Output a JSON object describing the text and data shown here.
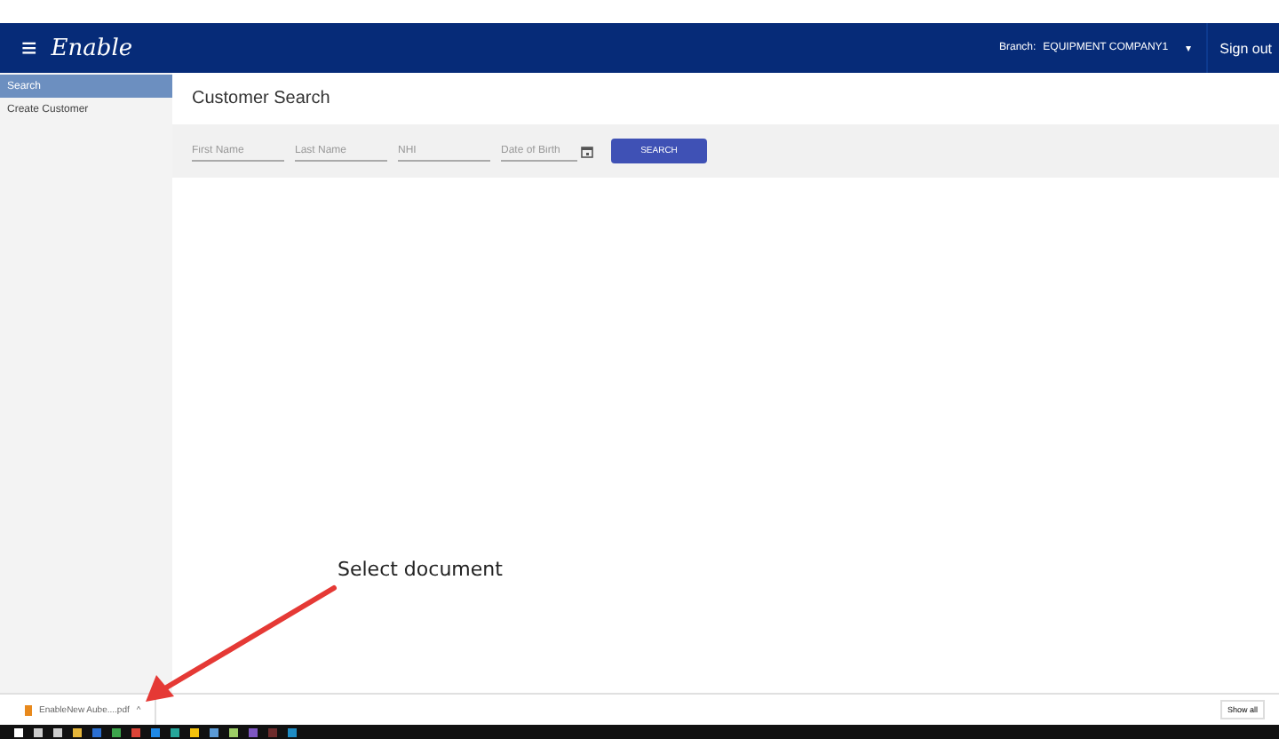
{
  "header": {
    "menu_icon": "≡",
    "logo": "Enable",
    "branch_label": "Branch:",
    "branch_value": "EQUIPMENT COMPANY1",
    "caret": "▾",
    "sign_out": "Sign out"
  },
  "sidebar": {
    "items": [
      {
        "label": "Search",
        "selected": true
      },
      {
        "label": "Create Customer",
        "selected": false
      }
    ]
  },
  "page_title": "Customer Search",
  "search_fields": [
    {
      "placeholder": "First Name",
      "kind": "text"
    },
    {
      "placeholder": "Last Name",
      "kind": "text"
    },
    {
      "placeholder": "NHI",
      "kind": "text"
    },
    {
      "placeholder": "Date of Birth",
      "kind": "date"
    }
  ],
  "search_button": "SEARCH",
  "annotation": "Select document",
  "download_bar": {
    "file": "EnableNew Aube....pdf",
    "caret": "^",
    "show_all": "Show all"
  }
}
